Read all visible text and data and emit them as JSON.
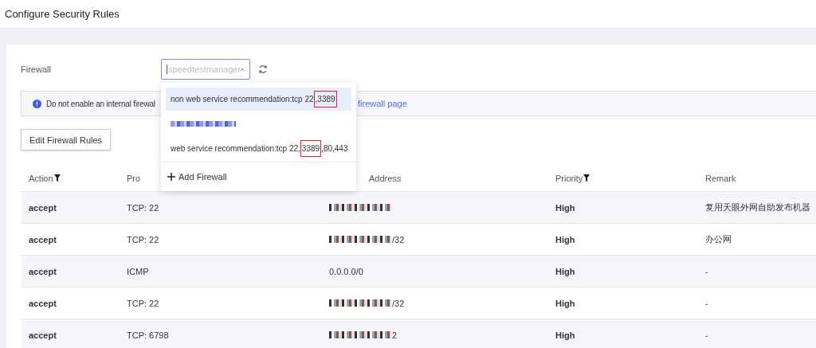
{
  "header": {
    "title": "Configure Security Rules"
  },
  "firewall": {
    "label": "Firewall",
    "select": {
      "placeholder": "speedtestmanager",
      "expanded": true
    },
    "options": [
      {
        "kind": "text",
        "text": "non web service recommendation:tcp 22",
        "highlight": ",3389",
        "selected": true
      },
      {
        "kind": "redacted",
        "selected": false
      },
      {
        "kind": "text",
        "text": "web service recommendation:tcp 22,",
        "highlight": "3389",
        "after": ",80,443",
        "selected": false
      }
    ],
    "add_label": "Add Firewall"
  },
  "alert": {
    "text": "Do not enable an internal firewal",
    "link": "firewall page"
  },
  "edit_button": "Edit Firewall Rules",
  "table": {
    "columns": [
      {
        "label": "Action",
        "filter": true
      },
      {
        "label": "Pro",
        "filter": false
      },
      {
        "label": "Address",
        "filter": false
      },
      {
        "label": "Priority",
        "filter": true
      },
      {
        "label": "Remark",
        "filter": false
      }
    ],
    "rows": [
      {
        "action": "accept",
        "protocol": "TCP: 22",
        "redacted": true,
        "priority": "High",
        "remark": "复用天眼外网自助发布机器"
      },
      {
        "action": "accept",
        "protocol": "TCP: 22",
        "address": "/32",
        "redacted": true,
        "priority": "High",
        "remark": "办公网"
      },
      {
        "action": "accept",
        "protocol": "ICMP",
        "address": "0.0.0.0/0",
        "redacted": false,
        "priority": "High",
        "remark": "-"
      },
      {
        "action": "accept",
        "protocol": "TCP: 22",
        "address": "/32",
        "redacted": true,
        "priority": "High",
        "remark": "-"
      },
      {
        "action": "accept",
        "protocol": "TCP: 6798",
        "address": "2",
        "redacted": true,
        "priority": "High",
        "remark": "-"
      }
    ]
  }
}
